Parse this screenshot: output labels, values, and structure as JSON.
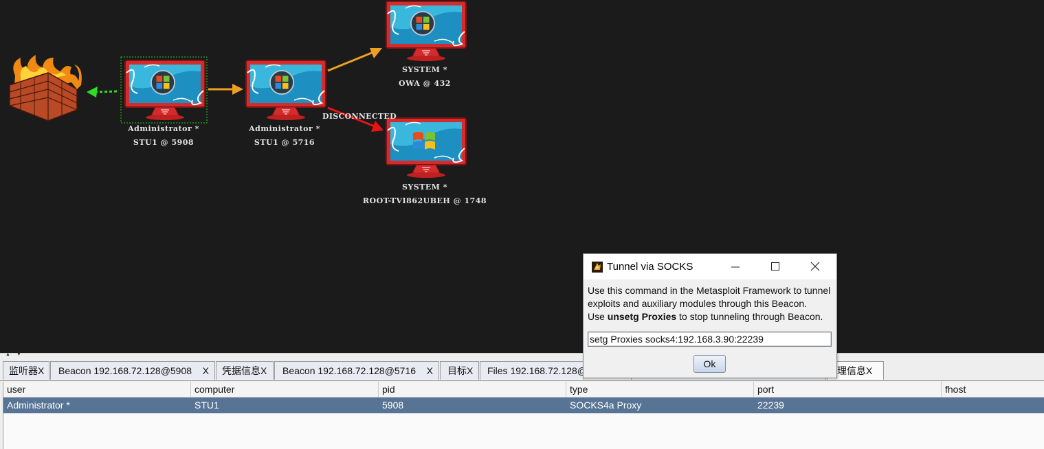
{
  "graph": {
    "nodes": [
      {
        "user": "Administrator *",
        "host": "STU1 @ 5908"
      },
      {
        "user": "Administrator *",
        "host": "STU1 @ 5716"
      },
      {
        "user": "SYSTEM *",
        "host": "OWA @ 432"
      },
      {
        "user": "SYSTEM *",
        "host": "ROOT-TVI862UBEH @ 1748"
      }
    ],
    "edge_label": "DISCONNECTED"
  },
  "tabs": [
    {
      "label": "监听器",
      "close": "X"
    },
    {
      "label": "Beacon 192.168.72.128@5908",
      "close": "X"
    },
    {
      "label": "凭据信息",
      "close": "X"
    },
    {
      "label": "Beacon 192.168.72.128@5716",
      "close": "X"
    },
    {
      "label": "目标",
      "close": "X"
    },
    {
      "label": "Files 192.168.72.128@",
      "close": ""
    },
    {
      "label": "代理信息",
      "close": "X"
    }
  ],
  "table": {
    "columns": [
      "user",
      "computer",
      "pid",
      "type",
      "port",
      "fhost"
    ],
    "rows": [
      [
        "Administrator *",
        "STU1",
        "5908",
        "SOCKS4a Proxy",
        "22239",
        ""
      ]
    ]
  },
  "dialog": {
    "title": "Tunnel via SOCKS",
    "line1": "Use this command in the Metasploit Framework to tunnel",
    "line2": "exploits and auxiliary modules through this Beacon.",
    "line3_pre": "Use ",
    "line3_bold": "unsetg Proxies",
    "line3_post": " to stop tunneling through Beacon.",
    "command": "setg Proxies socks4:192.168.3.90:22239",
    "ok_label": "Ok",
    "controls": {
      "minimize": "minimize-icon",
      "maximize": "maximize-icon",
      "close": "close-icon"
    }
  },
  "colors": {
    "graph_bg": "#1b1b1b",
    "selected_row": "#587494",
    "edge_active": "#f0a020",
    "edge_pivot": "#33dd22",
    "edge_disconnected": "#ee1111"
  }
}
